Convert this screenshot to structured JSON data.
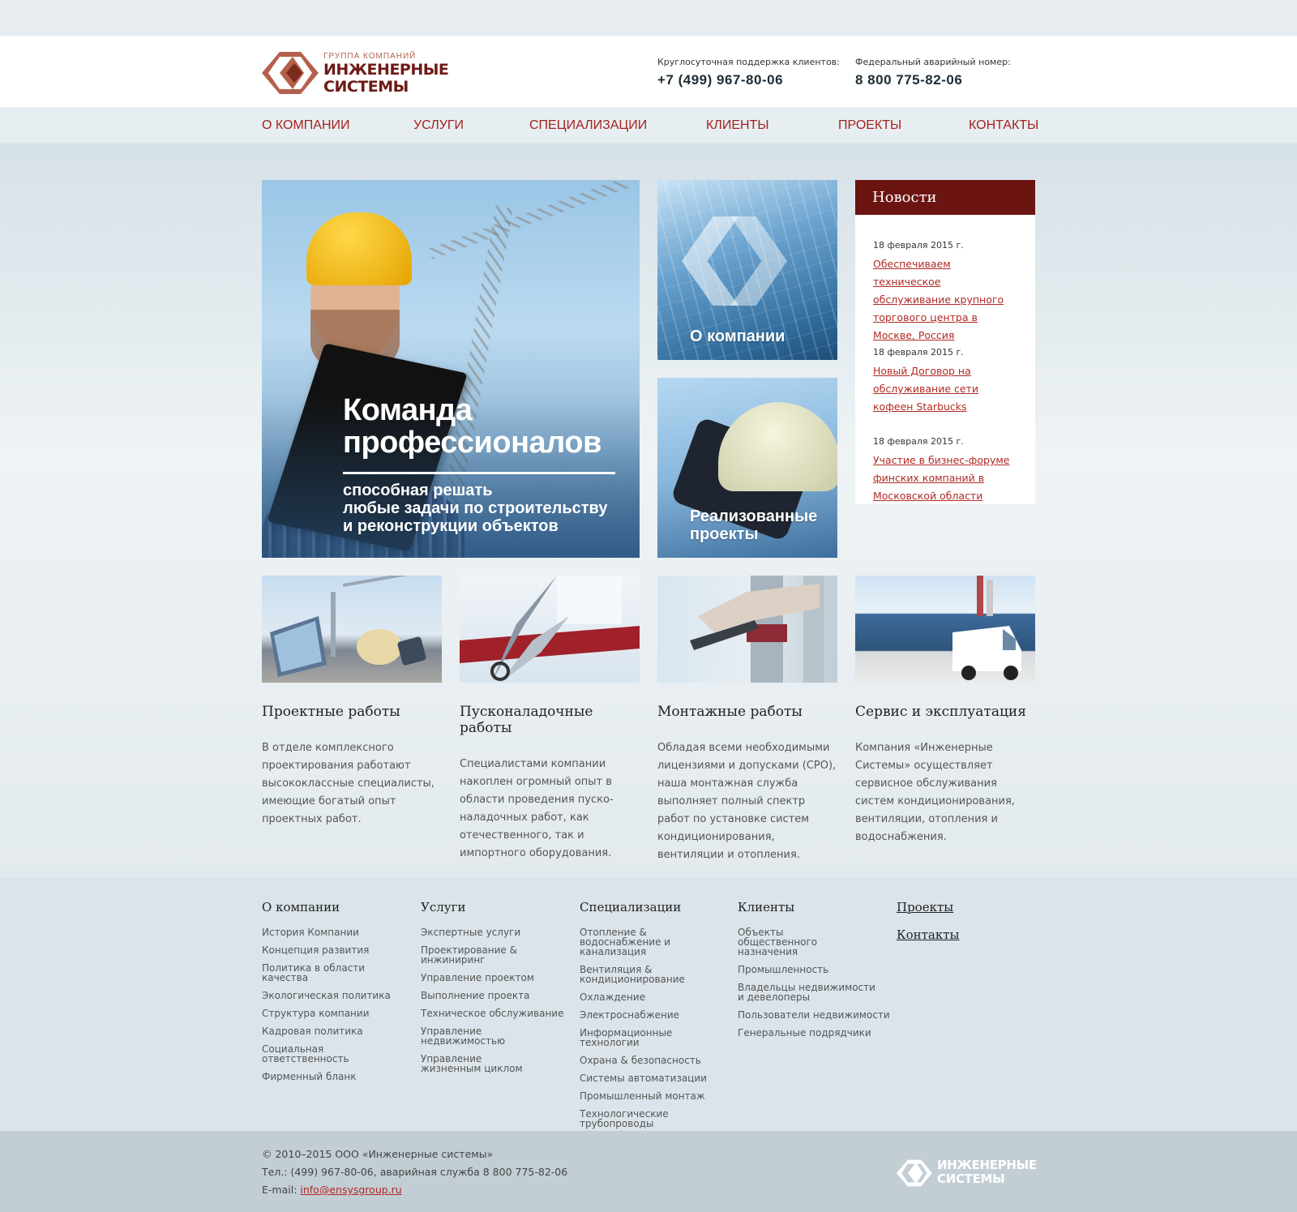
{
  "brand": {
    "small": "ГРУППА КОМПАНИЙ",
    "line1": "ИНЖЕНЕРНЫЕ",
    "line2": "СИСТЕМЫ",
    "color": "#6e1b17"
  },
  "contacts": {
    "support_label": "Круглосуточная поддержка клиентов:",
    "support_phone": "+7 (499) 967-80-06",
    "emergency_label": "Федеральный аварийный номер:",
    "emergency_phone": "8 800 775-82-06"
  },
  "nav": {
    "items": [
      "О КОМПАНИИ",
      "УСЛУГИ",
      "СПЕЦИАЛИЗАЦИИ",
      "КЛИЕНТЫ",
      "ПРОЕКТЫ",
      "КОНТАКТЫ"
    ]
  },
  "hero": {
    "title_line1": "Команда",
    "title_line2": "профессионалов",
    "subtitle_line1": "способная решать",
    "subtitle_line2": "любые задачи по строительству",
    "subtitle_line3": "и реконструкции объектов"
  },
  "tiles": {
    "about": "О компании",
    "projects_line1": "Реализованные",
    "projects_line2": "проекты"
  },
  "news": {
    "title": "Новости",
    "items": [
      {
        "date": "18 февраля 2015 г.",
        "text": "Обеспечиваем техническое обслуживание крупного торгового центра в Москве, Россия"
      },
      {
        "date": "18 февраля 2015 г.",
        "text": "Новый Договор на обслуживание сети кофеен Starbucks"
      },
      {
        "date": "18 февраля 2015 г.",
        "text": "Участие в бизнес-форуме финских компаний в Московской области"
      }
    ]
  },
  "services": [
    {
      "title": "Проектные работы",
      "text": "В отделе комплексного проектирования работают высококлассные специалисты, имеющие богатый опыт проектных работ."
    },
    {
      "title": "Пусконаладочные работы",
      "text": "Специалистами компании накоплен огромный опыт в области проведения пуско-наладочных работ, как отечественного, так и импортного оборудования."
    },
    {
      "title": "Монтажные работы",
      "text": "Обладая всеми необходимыми лицензиями и допусками (СРО), наша монтажная служба выполняет полный спектр работ по установке систем кондиционирования, вентиляции и отопления."
    },
    {
      "title": "Сервис и эксплуатация",
      "text": "Компания «Инженерные Системы» осуществляет сервисное обслуживания систем кондиционирования, вентиляции, отопления и водоснабжения."
    }
  ],
  "footer": {
    "col1": {
      "title": "О компании",
      "items": [
        "История Компании",
        "Концепция развития",
        "Политика в области качества",
        "Экологическая политика",
        "Структура компании",
        "Кадровая политика",
        "Социальная ответственность",
        "Фирменный бланк"
      ]
    },
    "col2": {
      "title": "Услуги",
      "items": [
        "Экспертные услуги",
        "Проектирование & инжиниринг",
        "Управление проектом",
        "Выполнение проекта",
        "Техническое обслуживание",
        "Управление недвижимостью",
        "Управление жизненным циклом"
      ]
    },
    "col3": {
      "title": "Специализации",
      "items": [
        "Отопление & водоснабжение и канализация",
        "Вентиляция & кондиционирование",
        "Охлаждение",
        "Электроснабжение",
        "Информационные технологии",
        "Охрана & безопасность",
        "Системы автоматизации",
        "Промышленный монтаж",
        "Технологические трубопроводы"
      ]
    },
    "col4": {
      "title": "Клиенты",
      "items": [
        "Объекты общественного назначения",
        "Промышленность",
        "Владельцы недвижимости и девелоперы",
        "Пользователи недвижимости",
        "Генеральные подрядчики"
      ]
    },
    "col5": {
      "links": [
        "Проекты",
        "Контакты"
      ]
    }
  },
  "bottom": {
    "copyright": "© 2010–2015 ООО «Инженерные системы»",
    "phones": "Тел.: (499) 967-80-06, аварийная служба 8 800 775-82-06",
    "email_label": "E-mail: ",
    "email": "info@ensysgroup.ru",
    "logo_line1": "ИНЖЕНЕРНЫЕ",
    "logo_line2": "СИСТЕМЫ"
  }
}
